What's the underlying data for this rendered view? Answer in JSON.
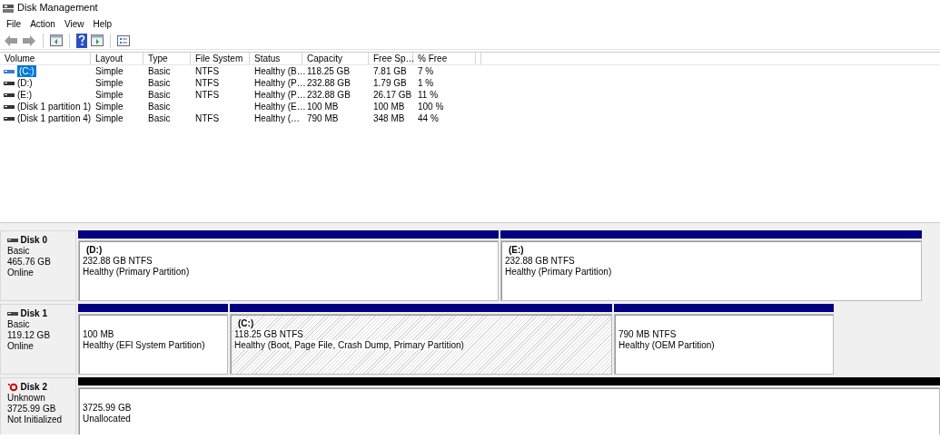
{
  "window": {
    "title": "Disk Management"
  },
  "menu": [
    "File",
    "Action",
    "View",
    "Help"
  ],
  "toolbar": [
    {
      "kind": "back",
      "disabled": true
    },
    {
      "kind": "forward",
      "disabled": true
    },
    {
      "kind": "separator"
    },
    {
      "kind": "console-tree"
    },
    {
      "kind": "separator"
    },
    {
      "kind": "help"
    },
    {
      "kind": "action-pane"
    },
    {
      "kind": "separator"
    },
    {
      "kind": "properties"
    }
  ],
  "table": {
    "columns": [
      "Volume",
      "Layout",
      "Type",
      "File System",
      "Status",
      "Capacity",
      "Free Sp…",
      "% Free"
    ],
    "rows": [
      {
        "selected": true,
        "cells": [
          "(C:)",
          "Simple",
          "Basic",
          "NTFS",
          "Healthy (B…",
          "118.25 GB",
          "7.81 GB",
          "7 %"
        ]
      },
      {
        "selected": false,
        "cells": [
          "(D:)",
          "Simple",
          "Basic",
          "NTFS",
          "Healthy (P…",
          "232.88 GB",
          "1.79 GB",
          "1 %"
        ]
      },
      {
        "selected": false,
        "cells": [
          "(E:)",
          "Simple",
          "Basic",
          "NTFS",
          "Healthy (P…",
          "232.88 GB",
          "26.17 GB",
          "11 %"
        ]
      },
      {
        "selected": false,
        "cells": [
          "(Disk 1 partition 1)",
          "Simple",
          "Basic",
          "",
          "Healthy (E…",
          "100 MB",
          "100 MB",
          "100 %"
        ]
      },
      {
        "selected": false,
        "cells": [
          "(Disk 1 partition 4)",
          "Simple",
          "Basic",
          "NTFS",
          "Healthy (…",
          "790 MB",
          "348 MB",
          "44 %"
        ]
      }
    ]
  },
  "disks": [
    {
      "kind": "online",
      "name": "Disk 0",
      "type": "Basic",
      "size": "465.76 GB",
      "state": "Online",
      "partitions": [
        {
          "kind": "primary",
          "selected": false,
          "name": "(D:)",
          "size": "232.88 GB NTFS",
          "status": "Healthy (Primary Partition)"
        },
        {
          "kind": "primary",
          "selected": false,
          "name": "(E:)",
          "size": "232.88 GB NTFS",
          "status": "Healthy (Primary Partition)"
        }
      ]
    },
    {
      "kind": "online",
      "name": "Disk 1",
      "type": "Basic",
      "size": "119.12 GB",
      "state": "Online",
      "partitions": [
        {
          "kind": "primary",
          "selected": false,
          "size": "100 MB",
          "status": "Healthy (EFI System Partition)"
        },
        {
          "kind": "primary",
          "selected": true,
          "name": "(C:)",
          "size": "118.25 GB NTFS",
          "status": "Healthy (Boot, Page File, Crash Dump, Primary Partition)"
        },
        {
          "kind": "primary",
          "selected": false,
          "size": "790 MB NTFS",
          "status": "Healthy (OEM Partition)"
        }
      ]
    },
    {
      "kind": "not-initialized",
      "name": "Disk 2",
      "type": "Unknown",
      "size": "3725.99 GB",
      "state": "Not Initialized",
      "partitions": [
        {
          "kind": "unallocated",
          "selected": false,
          "size": "3725.99 GB",
          "status": "Unallocated"
        }
      ]
    }
  ]
}
